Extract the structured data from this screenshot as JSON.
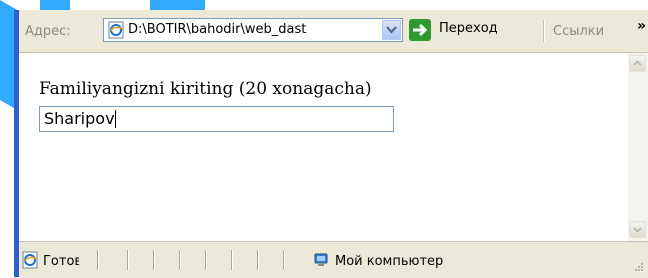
{
  "addressbar": {
    "label": "Адрес:",
    "url": "D:\\BOTIR\\bahodir\\web_dast",
    "go_label": "Переход",
    "links_label": "Ссылки",
    "overflow": "»"
  },
  "page": {
    "prompt": "Familiyangizni kiriting (20 xonagacha)",
    "input_value": "Sharipov"
  },
  "statusbar": {
    "status": "Готов",
    "zone": "Мой компьютер"
  },
  "colors": {
    "window_chrome": "#ece9d8",
    "window_edge": "#2f5fcc",
    "go_green": "#2e9a2e",
    "watermark": "#1aa0ff"
  },
  "icons": [
    "ie-page-icon",
    "dropdown-arrow-icon",
    "go-arrow-icon",
    "chevron-right-icon",
    "scroll-up-icon",
    "scroll-down-icon",
    "ie-status-icon",
    "my-computer-icon",
    "resize-grip-icon"
  ]
}
